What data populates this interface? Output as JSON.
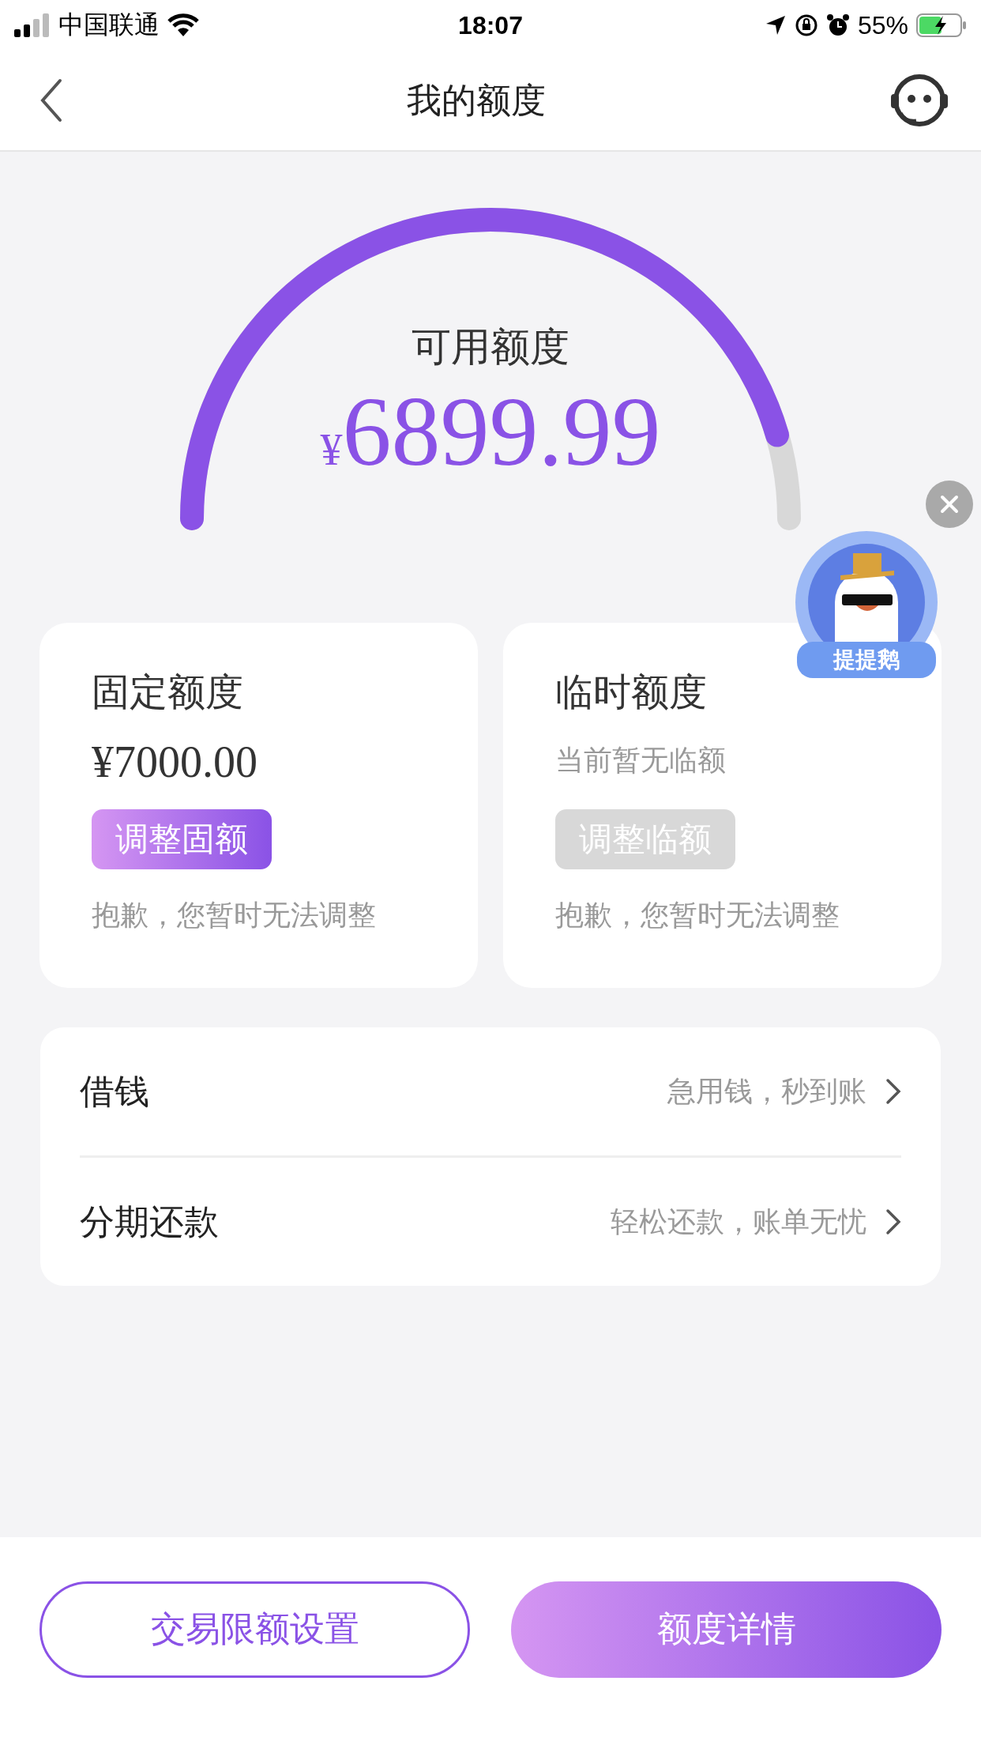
{
  "status_bar": {
    "carrier": "中国联通",
    "time": "18:07",
    "battery": "55%"
  },
  "nav": {
    "title": "我的额度"
  },
  "gauge": {
    "label": "可用额度",
    "currency": "¥",
    "amount": "6899.99"
  },
  "cards": [
    {
      "title": "固定额度",
      "value": "¥7000.00",
      "kind": "amount",
      "button": {
        "label": "调整固额",
        "disabled": false
      },
      "message": "抱歉，您暂时无法调整"
    },
    {
      "title": "临时额度",
      "value": "当前暂无临额",
      "kind": "note",
      "button": {
        "label": "调整临额",
        "disabled": true
      },
      "message": "抱歉，您暂时无法调整"
    }
  ],
  "menu": [
    {
      "label": "借钱",
      "hint": "急用钱，秒到账"
    },
    {
      "label": "分期还款",
      "hint": "轻松还款，账单无忧"
    }
  ],
  "mascot": {
    "label": "提提鹅"
  },
  "buttons": [
    {
      "label": "交易限额设置",
      "kind": "outline"
    },
    {
      "label": "额度详情",
      "kind": "filled"
    }
  ]
}
